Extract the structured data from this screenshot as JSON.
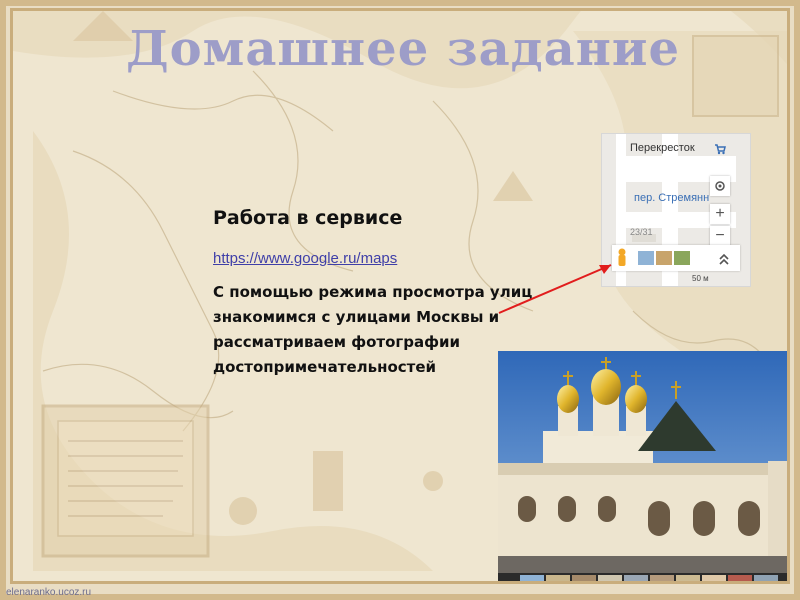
{
  "slide": {
    "title": "Домашнее задание",
    "heading": "Работа в сервисе",
    "link": "https://www.google.ru/maps",
    "description_lines": [
      "С помощью режима просмотра улиц",
      "знакомимся с улицами Москвы и",
      "рассматриваем фотографии",
      "достопримечательностей"
    ],
    "footer": "elenaranko.ucoz.ru"
  },
  "map_inset": {
    "store_label": "Перекресток",
    "street_label": "пер. Стремянн",
    "building_label": "23/31",
    "scale_label": "50 м",
    "controls": {
      "locate_icon": "target-icon",
      "zoom_in": "+",
      "zoom_out": "−",
      "expand_icon": "chevrons-up-icon"
    },
    "pegman_icon": "pegman-icon"
  },
  "colors": {
    "title": "#9d9dc8",
    "link": "#3f3fa8",
    "arrow": "#e11d1d",
    "frame": "#d2b98c",
    "background": "#efe6d0"
  }
}
